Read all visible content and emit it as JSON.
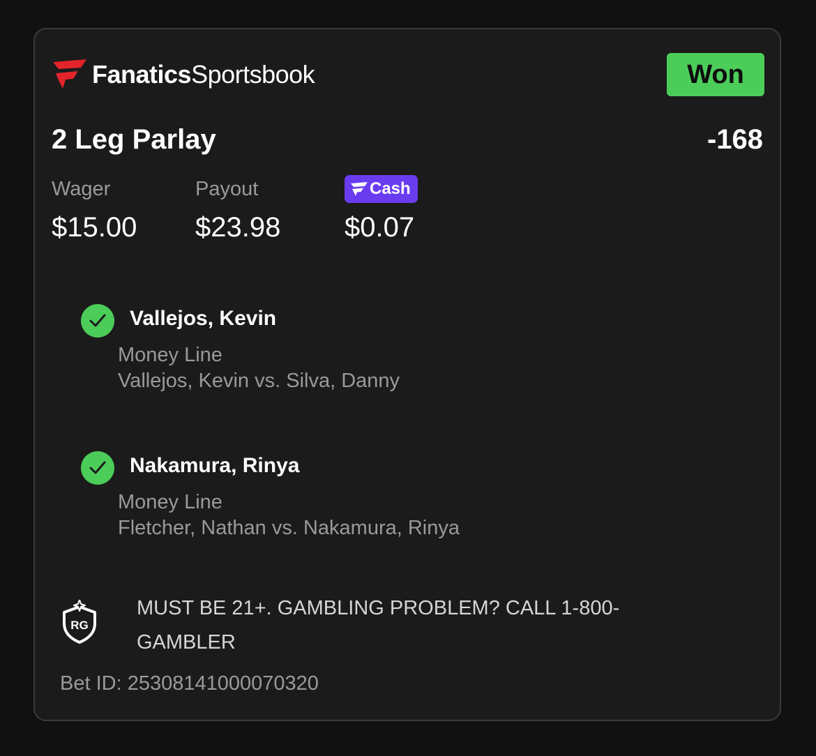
{
  "brand": {
    "name_bold": "Fanatics",
    "name_light": "Sportsbook",
    "logo_icon": "fanatics-flag-icon",
    "logo_color": "#e3242b"
  },
  "bet": {
    "status": "Won",
    "status_color": "#4ccd5a",
    "title": "2 Leg Parlay",
    "odds": "-168",
    "wager_label": "Wager",
    "wager_value": "$15.00",
    "payout_label": "Payout",
    "payout_value": "$23.98",
    "fcash_label": "Cash",
    "fcash_value": "$0.07",
    "fcash_color": "#6a3cf0"
  },
  "legs": [
    {
      "status_icon": "check-circle-icon",
      "selection": "Vallejos, Kevin",
      "market": "Money Line",
      "event": "Vallejos, Kevin vs. Silva, Danny"
    },
    {
      "status_icon": "check-circle-icon",
      "selection": "Nakamura, Rinya",
      "market": "Money Line",
      "event": "Fletcher, Nathan vs. Nakamura, Rinya"
    }
  ],
  "footer": {
    "rg_icon_text": "RG",
    "disclaimer": "MUST BE 21+. GAMBLING PROBLEM? CALL 1-800-GAMBLER",
    "bet_id": "Bet ID: 25308141000070320"
  }
}
